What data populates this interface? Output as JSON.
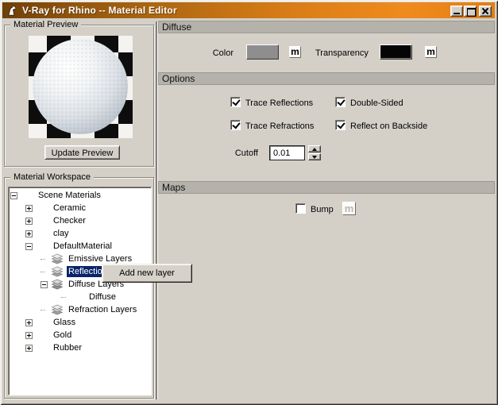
{
  "window": {
    "title": "V-Ray for Rhino -- Material Editor",
    "controls": [
      "minimize",
      "maximize",
      "close"
    ]
  },
  "preview": {
    "group_label": "Material Preview",
    "update_button": "Update Preview"
  },
  "workspace": {
    "group_label": "Material Workspace",
    "tree": [
      {
        "label": "Scene Materials",
        "depth": 0,
        "expander": "minus",
        "icon": "material-sphere-blue",
        "selected": false
      },
      {
        "label": "Ceramic",
        "depth": 1,
        "expander": "plus",
        "icon": "material-sphere-blue",
        "selected": false
      },
      {
        "label": "Checker",
        "depth": 1,
        "expander": "plus",
        "icon": "material-sphere-blue",
        "selected": false
      },
      {
        "label": "clay",
        "depth": 1,
        "expander": "plus",
        "icon": "material-sphere-blue",
        "selected": false
      },
      {
        "label": "DefaultMaterial",
        "depth": 1,
        "expander": "minus",
        "icon": "material-sphere-blue",
        "selected": false
      },
      {
        "label": "Emissive Layers",
        "depth": 2,
        "expander": "none",
        "icon": "layers-stack",
        "selected": false
      },
      {
        "label": "Reflection Layers",
        "depth": 2,
        "expander": "none",
        "icon": "layers-stack",
        "selected": true
      },
      {
        "label": "Diffuse Layers",
        "depth": 2,
        "expander": "minus",
        "icon": "layers-stack",
        "selected": false
      },
      {
        "label": "Diffuse",
        "depth": 3,
        "expander": "none",
        "icon": "material-sphere-gray",
        "selected": false
      },
      {
        "label": "Refraction Layers",
        "depth": 2,
        "expander": "none",
        "icon": "layers-stack",
        "selected": false
      },
      {
        "label": "Glass",
        "depth": 1,
        "expander": "plus",
        "icon": "material-sphere-blue",
        "selected": false
      },
      {
        "label": "Gold",
        "depth": 1,
        "expander": "plus",
        "icon": "material-sphere-blue",
        "selected": false
      },
      {
        "label": "Rubber",
        "depth": 1,
        "expander": "plus",
        "icon": "material-sphere-blue",
        "selected": false
      }
    ]
  },
  "context_menu": {
    "items": [
      {
        "label": "Add new layer"
      }
    ]
  },
  "diffuse_section": {
    "header": "Diffuse",
    "color_label": "Color",
    "color_value": "#8e8e8e",
    "color_map_button": "m",
    "transparency_label": "Transparency",
    "transparency_value": "#050505",
    "transparency_map_button": "m"
  },
  "options_section": {
    "header": "Options",
    "checkboxes": [
      {
        "label": "Trace Reflections",
        "checked": true
      },
      {
        "label": "Double-Sided",
        "checked": true
      },
      {
        "label": "Trace Refractions",
        "checked": true
      },
      {
        "label": "Reflect on Backside",
        "checked": true
      }
    ],
    "cutoff_label": "Cutoff",
    "cutoff_value": "0.01"
  },
  "maps_section": {
    "header": "Maps",
    "bump_label": "Bump",
    "bump_checked": false,
    "bump_map_button": "m"
  },
  "colors": {
    "titlebar_start": "#6e3f08",
    "titlebar_end": "#ef8b1e",
    "window_bg": "#d4d0c8",
    "section_header_bg": "#b5b2ab",
    "selection_bg": "#0a246a",
    "selection_text": "#ffffff",
    "tree_bg": "#ffffff"
  }
}
